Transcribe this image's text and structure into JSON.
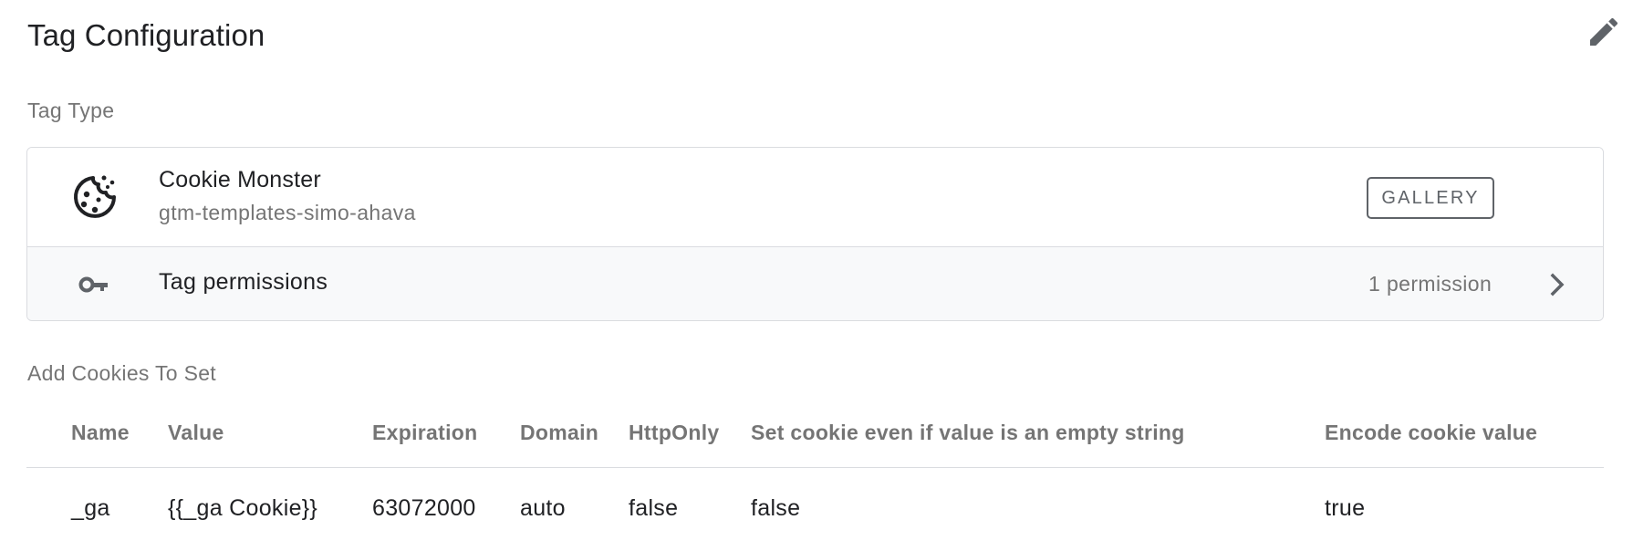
{
  "header": {
    "title": "Tag Configuration",
    "edit_icon": "pencil-icon"
  },
  "tag_type": {
    "section_label": "Tag Type",
    "template_name": "Cookie Monster",
    "template_source": "gtm-templates-simo-ahava",
    "template_icon": "cookie-icon",
    "gallery_label": "GALLERY",
    "permissions": {
      "icon": "key-icon",
      "label": "Tag permissions",
      "count_text": "1 permission",
      "chevron_icon": "chevron-right-icon"
    }
  },
  "cookies": {
    "section_label": "Add Cookies To Set",
    "columns": [
      "Name",
      "Value",
      "Expiration",
      "Domain",
      "HttpOnly",
      "Set cookie even if value is an empty string",
      "Encode cookie value"
    ],
    "rows": [
      [
        "_ga",
        "{{_ga Cookie}}",
        "63072000",
        "auto",
        "false",
        "false",
        "true"
      ]
    ]
  },
  "colors": {
    "text_primary": "#202124",
    "text_secondary": "#757575",
    "border": "#dadce0",
    "row_bg": "#f8f9fa",
    "icon": "#5f6368"
  }
}
